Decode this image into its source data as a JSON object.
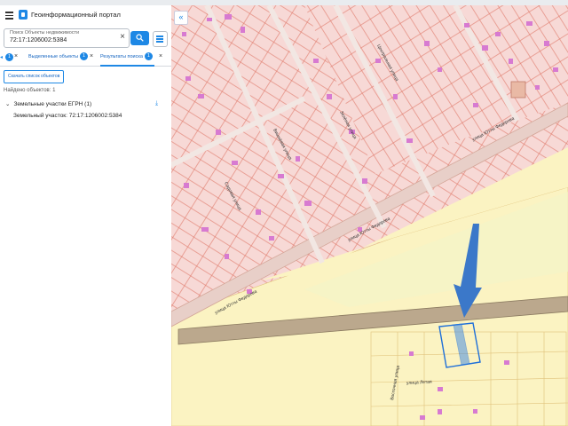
{
  "app": {
    "title": "Геоинформационный портал"
  },
  "search": {
    "placeholder": "Поиск Объекты недвижимости",
    "value": "72:17:1206002:5384"
  },
  "tabs": [
    {
      "label": "Выделенные объекты",
      "badge": "1"
    },
    {
      "label": "Результаты поиска",
      "badge": "1"
    }
  ],
  "results": {
    "download_label": "Скачать список объектов",
    "found_label": "Найдено объектов: 1",
    "group_label": "Земельные участки ЕГРН (1)",
    "item_label": "Земельный участок: 72:17:1206002:5384"
  },
  "map": {
    "collapse_glyph": "«",
    "streets": [
      "улица Ютты Федорова",
      "улица Ютты Федорова",
      "улица Ютты Федорова",
      "Садовая улица",
      "Вишнёвая улица",
      "Зелёная улица",
      "Центральная улица",
      "улица Летая",
      "Восточная улица"
    ],
    "colors": {
      "residential": "#f7d9d6",
      "parcel_border": "#e07b6b",
      "building": "#d77ad1",
      "field": "#fbf3c2",
      "road": "#bba88d",
      "arrow": "#3b78c9",
      "highlight": "#1e6fd9"
    }
  }
}
